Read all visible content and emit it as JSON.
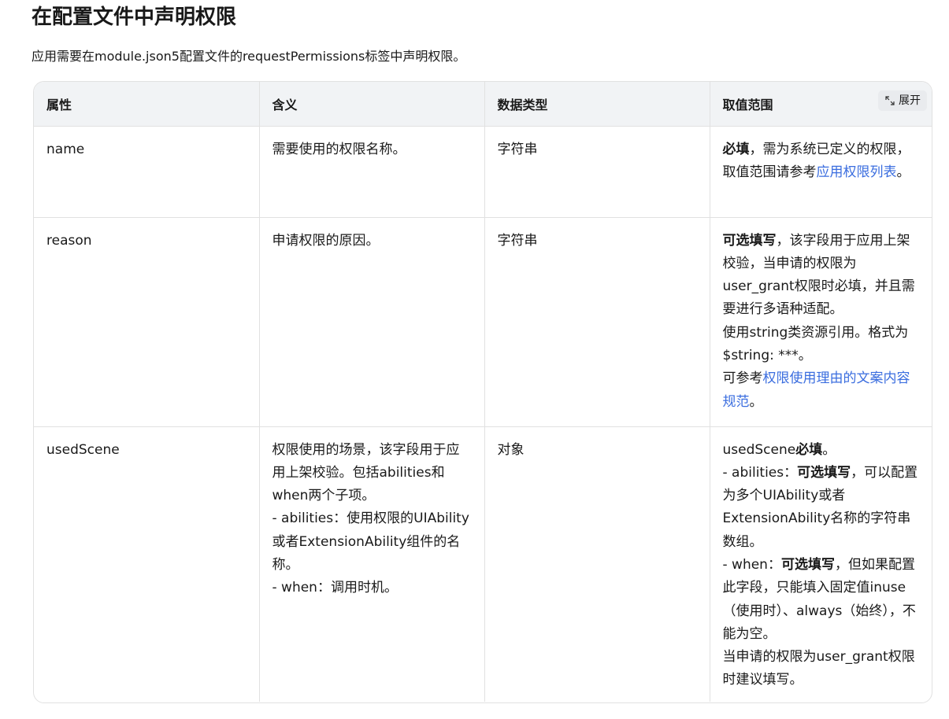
{
  "heading": "在配置文件中声明权限",
  "intro": "应用需要在module.json5配置文件的requestPermissions标签中声明权限。",
  "table": {
    "headers": [
      "属性",
      "含义",
      "数据类型",
      "取值范围"
    ],
    "expand_label": "展开",
    "rows": [
      {
        "attr": "name",
        "meaning": "需要使用的权限名称。",
        "type": "字符串",
        "range": {
          "bold1": "必填",
          "text1": "，需为系统已定义的权限，取值范围请参考",
          "link1": "应用权限列表",
          "text2": "。"
        }
      },
      {
        "attr": "reason",
        "meaning": "申请权限的原因。",
        "type": "字符串",
        "range": {
          "bold1": "可选填写",
          "text1": "，该字段用于应用上架校验，当申请的权限为user_grant权限时必填，并且需要进行多语种适配。",
          "text2": "使用string类资源引用。格式为$string: ***。",
          "text3": "可参考",
          "link1": "权限使用理由的文案内容规范",
          "text4": "。"
        }
      },
      {
        "attr": "usedScene",
        "meaning_lines": [
          "权限使用的场景，该字段用于应用上架校验。包括abilities和when两个子项。",
          "- abilities：使用权限的UIAbility或者ExtensionAbility组件的名称。",
          "- when：调用时机。"
        ],
        "type": "对象",
        "range": {
          "p1_text": "usedScene",
          "p1_bold": "必填",
          "p1_end": "。",
          "p2_text": "- abilities：",
          "p2_bold": "可选填写",
          "p2_end": "，可以配置为多个UIAbility或者ExtensionAbility名称的字符串数组。",
          "p3_text": "- when：",
          "p3_bold": "可选填写",
          "p3_end": "，但如果配置此字段，只能填入固定值inuse（使用时）、always（始终），不能为空。",
          "p4_text": "当申请的权限为user_grant权限时建议填写。"
        }
      }
    ]
  },
  "colors": {
    "header_bg": "#f1f3f5",
    "border": "#e1e1e1",
    "link": "#3a6ddf"
  }
}
